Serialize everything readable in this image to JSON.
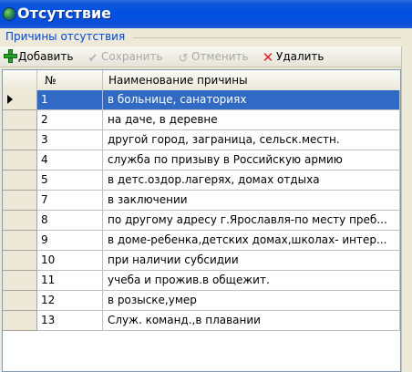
{
  "window": {
    "title": "Отсутствие"
  },
  "group": {
    "label": "Причины отсутствия"
  },
  "toolbar": {
    "add_label": "Добавить",
    "save_label": "Сохранить",
    "cancel_label": "Отменить",
    "delete_label": "Удалить"
  },
  "table": {
    "columns": [
      "№",
      "Наименование причины"
    ],
    "rows": [
      {
        "num": "1",
        "name": "в больнице, санаториях",
        "selected": true
      },
      {
        "num": "2",
        "name": "на даче, в деревне"
      },
      {
        "num": "3",
        "name": " другой город, заграница, сельск.местн."
      },
      {
        "num": "4",
        "name": "служба по призыву в Российскую армию"
      },
      {
        "num": "5",
        "name": "в детс.оздор.лагерях, домах отдыха"
      },
      {
        "num": "7",
        "name": "в заключении"
      },
      {
        "num": "8",
        "name": "по другому адресу г.Ярославля-по месту преб..."
      },
      {
        "num": "9",
        "name": "в доме-ребенка,детских домах,школах- интер..."
      },
      {
        "num": "10",
        "name": "при наличии субсидии"
      },
      {
        "num": "11",
        "name": "учеба и прожив.в общежит."
      },
      {
        "num": "12",
        "name": "в розыске,умер"
      },
      {
        "num": "13",
        "name": "Служ. команд.,в плавании"
      }
    ]
  },
  "colors": {
    "title_bar": "#0050e0",
    "selection": "#316ac5",
    "group_label": "#0046d5"
  },
  "icons": {
    "title": "globe-icon",
    "add": "plus-icon",
    "save": "checkmark-icon",
    "cancel": "undo-icon",
    "delete": "x-icon",
    "row_pointer": "row-pointer-icon"
  }
}
